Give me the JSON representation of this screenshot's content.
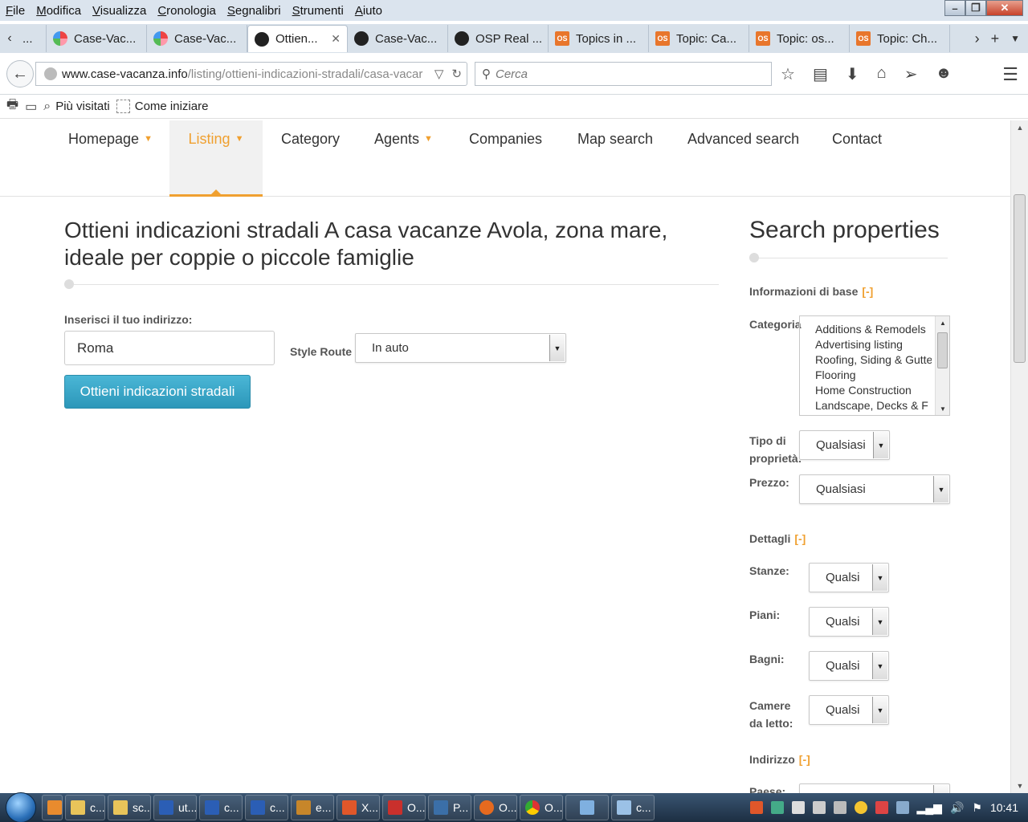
{
  "menubar": [
    "File",
    "Modifica",
    "Visualizza",
    "Cronologia",
    "Segnalibri",
    "Strumenti",
    "Aiuto"
  ],
  "tabs": [
    {
      "label": "...",
      "icon": "joomla"
    },
    {
      "label": "Case-Vac...",
      "icon": "joomla"
    },
    {
      "label": "Case-Vac...",
      "icon": "joomla"
    },
    {
      "label": "Ottien...",
      "icon": "joomla-dark",
      "active": true
    },
    {
      "label": "Case-Vac...",
      "icon": "joomla-dark"
    },
    {
      "label": "OSP Real ...",
      "icon": "joomla-dark"
    },
    {
      "label": "Topics in ...",
      "icon": "os"
    },
    {
      "label": "Topic: Ca...",
      "icon": "os"
    },
    {
      "label": "Topic: os...",
      "icon": "os"
    },
    {
      "label": "Topic: Ch...",
      "icon": "os"
    }
  ],
  "url": {
    "domain": "www.case-vacanza.info",
    "path": "/listing/ottieni-indicazioni-stradali/casa-vacar"
  },
  "search_placeholder": "Cerca",
  "bookmarks": [
    "Più visitati",
    "Come iniziare"
  ],
  "site_nav": [
    {
      "label": "Homepage",
      "caret": true
    },
    {
      "label": "Listing",
      "caret": true,
      "active": true
    },
    {
      "label": "Category",
      "caret": false
    },
    {
      "label": "Agents",
      "caret": true
    },
    {
      "label": "Companies",
      "caret": false
    },
    {
      "label": "Map search",
      "caret": false
    },
    {
      "label": "Advanced search",
      "caret": false
    },
    {
      "label": "Contact",
      "caret": false
    }
  ],
  "main": {
    "title": "Ottieni indicazioni stradali A casa vacanze Avola, zona mare, ideale per coppie o piccole famiglie",
    "address_label": "Inserisci il tuo indirizzo:",
    "address_value": "Roma",
    "route_label": "Style Route",
    "route_value": "In auto",
    "button": "Ottieni indicazioni stradali"
  },
  "sidebar": {
    "title": "Search properties",
    "basic": {
      "label": "Informazioni di base",
      "toggle": "[-]"
    },
    "category_label": "Categoria",
    "categories": [
      "Additions & Remodels",
      "Advertising listing",
      "Roofing, Siding & Gutters",
      "Flooring",
      "Home Construction",
      "Landscape, Decks & F"
    ],
    "type_label": "Tipo di proprietà:",
    "type_value": "Qualsiasi",
    "price_label": "Prezzo:",
    "price_value": "Qualsiasi",
    "details": {
      "label": "Dettagli",
      "toggle": "[-]"
    },
    "rooms_label": "Stanze:",
    "rooms_value": "Qualsi",
    "floors_label": "Piani:",
    "floors_value": "Qualsi",
    "baths_label": "Bagni:",
    "baths_value": "Qualsi",
    "bedrooms_label": "Camere da letto:",
    "bedrooms_value": "Qualsi",
    "address": {
      "label": "Indirizzo",
      "toggle": "[-]"
    },
    "country_label": "Paese:"
  },
  "taskbar": {
    "items": [
      "c...",
      "sc...",
      "ut...",
      "c...",
      "c...",
      "e...",
      "X...",
      "O...",
      "P...",
      "O...",
      "O...",
      "",
      "c..."
    ],
    "clock": "10:41"
  }
}
